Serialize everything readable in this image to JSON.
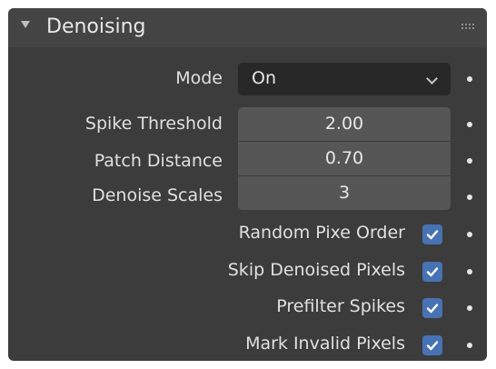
{
  "panel": {
    "title": "Denoising",
    "collapsed": false
  },
  "mode": {
    "label": "Mode",
    "value": "On"
  },
  "fields": {
    "spike_threshold": {
      "label": "Spike Threshold",
      "value": "2.00"
    },
    "patch_distance": {
      "label": "Patch Distance",
      "value": "0.70"
    },
    "denoise_scales": {
      "label": "Denoise Scales",
      "value": "3"
    }
  },
  "checkboxes": {
    "random_pixel_order": {
      "label": "Random Pixe Order",
      "checked": true
    },
    "skip_denoised_pixels": {
      "label": "Skip Denoised Pixels",
      "checked": true
    },
    "prefilter_spikes": {
      "label": "Prefilter Spikes",
      "checked": true
    },
    "mark_invalid_pixels": {
      "label": "Mark Invalid Pixels",
      "checked": true
    }
  },
  "colors": {
    "panel_bg": "#3c3c3c",
    "header_bg": "#444444",
    "field_bg": "#565656",
    "dropdown_bg": "#282828",
    "checkbox_accent": "#4772b3"
  }
}
